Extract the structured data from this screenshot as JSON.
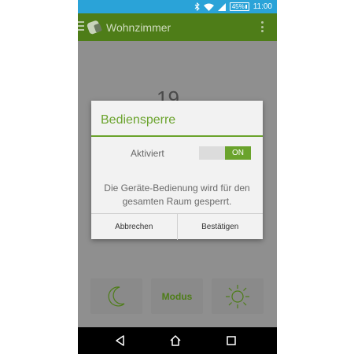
{
  "status_bar": {
    "battery": "45%",
    "time": "11:00",
    "icons": [
      "bluetooth-icon",
      "wifi-icon",
      "signal-icon",
      "battery-icon"
    ]
  },
  "app_bar": {
    "title": "Wohnzimmer",
    "icons": [
      "menu-icon",
      "thermostat-logo-icon",
      "overflow-menu-icon"
    ]
  },
  "main": {
    "temperature_partial": "19",
    "modes": {
      "night_icon": "moon-icon",
      "modus_label": "Modus",
      "day_icon": "sun-icon"
    }
  },
  "dialog": {
    "title": "Bediensperre",
    "switch_label": "Aktiviert",
    "switch_state": "ON",
    "message_line1": "Die Geräte-Bedienung wird für den",
    "message_line2": "gesamten Raum gesperrt.",
    "cancel_label": "Abbrechen",
    "confirm_label": "Bestätigen"
  },
  "nav_bar": {
    "icons": [
      "back-icon",
      "home-icon",
      "recents-icon"
    ]
  },
  "colors": {
    "accent_green": "#6aa32c",
    "appbar_green": "#4e7d18",
    "statusbar_blue": "#2aa3d8"
  }
}
